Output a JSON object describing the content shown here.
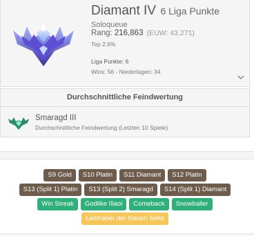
{
  "rank": {
    "tier": "Diamant IV",
    "lp_short": "6 Liga Punkte",
    "queue": "Soloqueue",
    "rang_label": "Rang:",
    "rang_value": "216,863",
    "euw": "(EUW: 43,271)",
    "top": "Top 2.6%",
    "lp_line": "Liga Punkte: 6",
    "wins_line": "Wins: 56 - Niederlagen: 34",
    "emblem_icon": "diamond-emblem-icon",
    "expand_icon": "chevron-down-icon"
  },
  "average": {
    "heading": "Durchschnittliche Feindwertung",
    "tier": "Smaragd III",
    "description": "Durchschnittliche Feindwertung (Letzten 10 Spiele)",
    "emblem_icon": "emerald-emblem-icon"
  },
  "tags": {
    "row1": [
      "S9 Gold",
      "S10 Platin",
      "S11 Diamant",
      "S12 Platin"
    ],
    "row2": [
      "S13 (Split 1) Platin",
      "S13 (Split 2) Smaragd",
      "S14 (Split 1) Diamant"
    ],
    "row3": [
      "Win Streak",
      "Godlike Illaoi",
      "Comeback",
      "Snowballer"
    ],
    "row4": [
      "Liebhaber der blauen Seite"
    ]
  },
  "colors": {
    "season_tag": "#6d5b4c",
    "achievement_tag": "#2fb07a",
    "special_tag": "#f7c65a",
    "panel": "#f5f5f5"
  }
}
